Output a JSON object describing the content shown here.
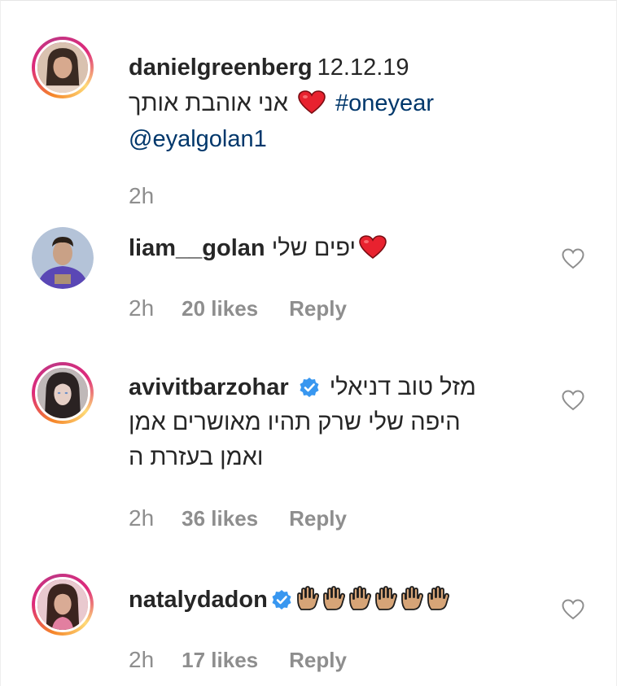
{
  "colors": {
    "text": "#262626",
    "muted": "#8e8e8e",
    "link": "#00376b",
    "verified": "#3897f0",
    "heart": "#e8222f"
  },
  "caption": {
    "username": "danielgreenberg",
    "date": "12.12.19",
    "text": "אני אוהבת אותך",
    "hashtag": "#oneyear",
    "mention": "@eyalgolan1",
    "time": "2h",
    "icons": [
      "heart-emoji"
    ]
  },
  "comments": [
    {
      "username": "liam__golan",
      "text": "יפים שלי",
      "time": "2h",
      "likes": "20 likes",
      "reply": "Reply",
      "verified": false,
      "icons": [
        "heart-emoji"
      ]
    },
    {
      "username": "avivitbarzohar",
      "text_line1": "מזל טוב דניאלי",
      "text_line2": "היפה שלי שרק תהיו מאושרים אמן",
      "text_line3": "ואמן בעזרת ה",
      "time": "2h",
      "likes": "36 likes",
      "reply": "Reply",
      "verified": true
    },
    {
      "username": "natalydadon",
      "time": "2h",
      "likes": "17 likes",
      "reply": "Reply",
      "verified": true,
      "icons": [
        "raised-hand-emoji",
        "raised-hand-emoji",
        "raised-hand-emoji",
        "raised-hand-emoji",
        "raised-hand-emoji",
        "raised-hand-emoji"
      ]
    }
  ]
}
